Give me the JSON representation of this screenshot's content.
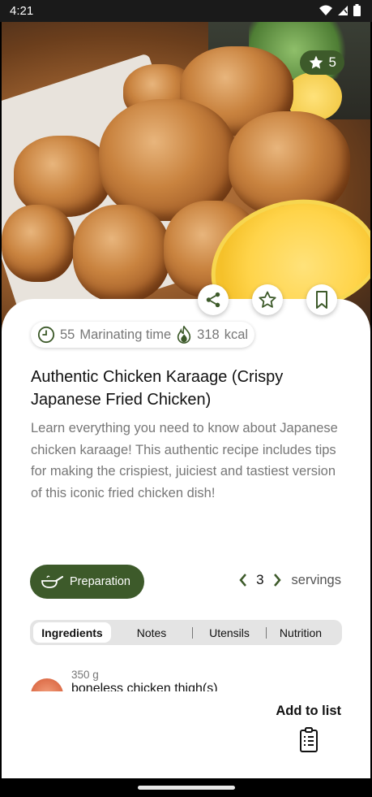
{
  "status_bar": {
    "time": "4:21"
  },
  "hero": {
    "rating": "5"
  },
  "actions": {
    "share": "share",
    "favorite": "favorite",
    "bookmark": "bookmark"
  },
  "meta": {
    "time_value": "55",
    "time_label": "Marinating time",
    "kcal_value": "318",
    "kcal_unit": "kcal"
  },
  "recipe": {
    "title": "Authentic Chicken Karaage (Crispy Japanese Fried Chicken)",
    "description": "Learn everything you need to know about Japanese chicken karaage! This authentic recipe includes tips for making the crispiest, juiciest and tastiest version of this iconic fried chicken dish!"
  },
  "preparation_button": {
    "label": "Preparation"
  },
  "servings": {
    "count": "3",
    "label": "servings"
  },
  "tabs": [
    {
      "label": "Ingredients",
      "active": true
    },
    {
      "label": "Notes",
      "active": false
    },
    {
      "label": "Utensils",
      "active": false
    },
    {
      "label": "Nutrition",
      "active": false
    }
  ],
  "ingredients": [
    {
      "quantity": "350 g",
      "name": "boneless chicken thigh(s)"
    }
  ],
  "add_to_list": {
    "label": "Add to list"
  },
  "colors": {
    "accent": "#3d5a2a",
    "text_secondary": "#777777"
  }
}
